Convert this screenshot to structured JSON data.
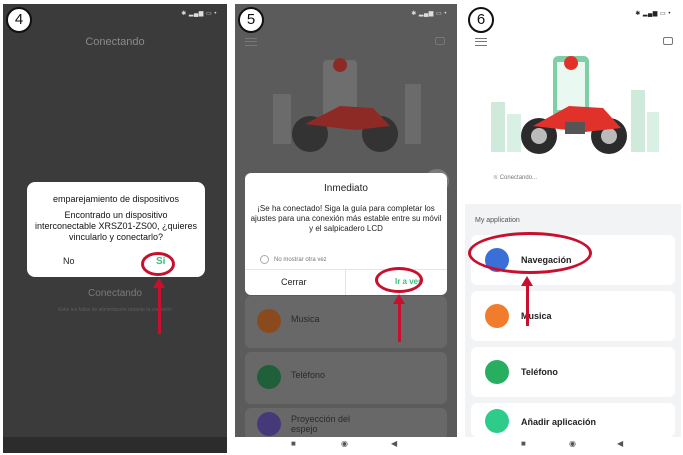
{
  "screens": [
    {
      "step": "4",
      "title": "Conectando",
      "dialog": {
        "title": "emparejamiento de dispositivos",
        "message": "Encontrado un dispositivo interconectable XRSZ01-ZS00, ¿quieres vincularlo y conectarlo?",
        "no_label": "No",
        "yes_label": "Sí"
      },
      "subtitle": "Conectando",
      "hint": "Evite los fallos de alimentación durante la conexión"
    },
    {
      "step": "5",
      "dialog": {
        "title": "Inmediato",
        "message": "¡Se ha conectado! Siga la guía para completar los ajustes para una conexión más estable entre su móvil y el salpicadero LCD",
        "checkbox_label": "No mostrar otra vez",
        "cancel_label": "Cerrar",
        "confirm_label": "Ir a ver"
      },
      "apps": [
        {
          "label": "Musica",
          "color": "#f07c2c"
        },
        {
          "label": "Teléfono",
          "color": "#27ae60"
        },
        {
          "label": "Proyección del espejo",
          "color": "#6c5ce7"
        }
      ]
    },
    {
      "step": "6",
      "status_text": "Conectando...",
      "section_title": "My application",
      "apps": [
        {
          "label": "Navegación",
          "color": "#3b6fd8"
        },
        {
          "label": "Musica",
          "color": "#f07c2c"
        },
        {
          "label": "Teléfono",
          "color": "#27ae60"
        },
        {
          "label": "Añadir aplicación",
          "color": "#2ecc8a"
        }
      ]
    }
  ],
  "colors": {
    "accent_green": "#3bbf7a",
    "annotation_red": "#c8102e",
    "bike_red": "#e0312b"
  }
}
